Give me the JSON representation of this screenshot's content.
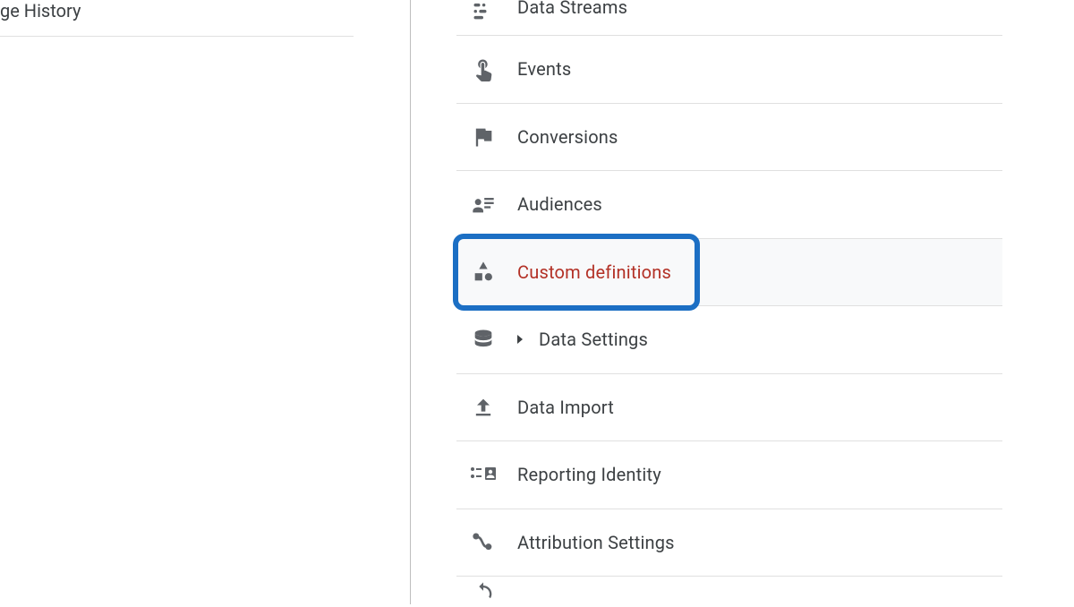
{
  "left_panel": {
    "history_label_fragment": "ge History"
  },
  "menu": {
    "items": [
      {
        "label": "Data Streams",
        "icon": "data-streams-icon"
      },
      {
        "label": "Events",
        "icon": "events-icon"
      },
      {
        "label": "Conversions",
        "icon": "conversions-icon"
      },
      {
        "label": "Audiences",
        "icon": "audiences-icon"
      },
      {
        "label": "Custom definitions",
        "icon": "custom-definitions-icon",
        "selected": true,
        "highlighted": true
      },
      {
        "label": "Data Settings",
        "icon": "data-settings-icon",
        "expandable": true
      },
      {
        "label": "Data Import",
        "icon": "data-import-icon"
      },
      {
        "label": "Reporting Identity",
        "icon": "reporting-identity-icon"
      },
      {
        "label": "Attribution Settings",
        "icon": "attribution-settings-icon"
      }
    ]
  },
  "colors": {
    "highlight_border": "#1C6FC4",
    "selected_text": "#b33126",
    "normal_text": "#3c4043",
    "icon": "#5f6368"
  }
}
